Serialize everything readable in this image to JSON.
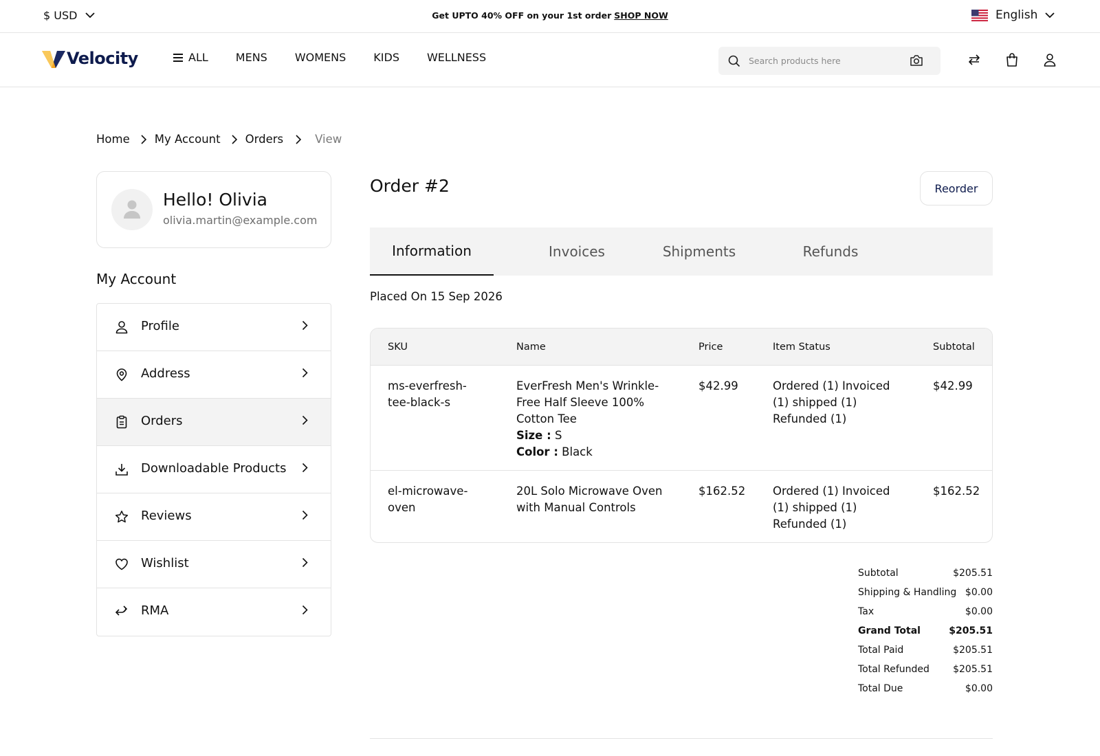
{
  "topbar": {
    "currency": "$ USD",
    "promo_text": "Get UPTO 40% OFF on your 1st order",
    "promo_link": "SHOP NOW",
    "language": "English"
  },
  "header": {
    "logo_text": "Velocity",
    "nav": [
      "ALL",
      "MENS",
      "WOMENS",
      "KIDS",
      "WELLNESS"
    ],
    "search_placeholder": "Search products here"
  },
  "breadcrumb": [
    "Home",
    "My Account",
    "Orders",
    "View"
  ],
  "profile": {
    "greeting": "Hello! Olivia",
    "email": "olivia.martin@example.com"
  },
  "sidebar": {
    "title": "My Account",
    "items": [
      {
        "label": "Profile",
        "icon": "user-icon"
      },
      {
        "label": "Address",
        "icon": "location-pin-icon"
      },
      {
        "label": "Orders",
        "icon": "clipboard-icon",
        "active": true
      },
      {
        "label": "Downloadable Products",
        "icon": "download-icon"
      },
      {
        "label": "Reviews",
        "icon": "star-icon"
      },
      {
        "label": "Wishlist",
        "icon": "heart-icon"
      },
      {
        "label": "RMA",
        "icon": "return-arrows-icon"
      }
    ]
  },
  "order": {
    "title": "Order #2",
    "reorder_label": "Reorder",
    "tabs": [
      "Information",
      "Invoices",
      "Shipments",
      "Refunds"
    ],
    "active_tab": "Information",
    "placed_on": "Placed On 15 Sep 2026",
    "columns": [
      "SKU",
      "Name",
      "Price",
      "Item Status",
      "Subtotal"
    ],
    "items": [
      {
        "sku": "ms-everfresh-tee-black-s",
        "name": "EverFresh Men's Wrinkle-Free Half Sleeve 100% Cotton Tee",
        "options": [
          {
            "label": "Size :",
            "value": "S"
          },
          {
            "label": "Color :",
            "value": "Black"
          }
        ],
        "price": "$42.99",
        "status": "Ordered (1) Invoiced (1) shipped (1) Refunded (1)",
        "subtotal": "$42.99"
      },
      {
        "sku": "el-microwave-oven",
        "name": "20L Solo Microwave Oven with Manual Controls",
        "options": [],
        "price": "$162.52",
        "status": "Ordered (1) Invoiced (1) shipped (1) Refunded (1)",
        "subtotal": "$162.52"
      }
    ],
    "totals": [
      {
        "label": "Subtotal",
        "value": "$205.51"
      },
      {
        "label": "Shipping & Handling",
        "value": "$0.00"
      },
      {
        "label": "Tax",
        "value": "$0.00"
      },
      {
        "label": "Grand Total",
        "value": "$205.51",
        "bold": true
      },
      {
        "label": "Total Paid",
        "value": "$205.51"
      },
      {
        "label": "Total Refunded",
        "value": "$205.51"
      },
      {
        "label": "Total Due",
        "value": "$0.00"
      }
    ]
  },
  "colors": {
    "brand_navy": "#0e1b4d",
    "logo_orange": "#f5a623",
    "panel_gray": "#f3f3f3",
    "border": "#e3e3e3"
  }
}
